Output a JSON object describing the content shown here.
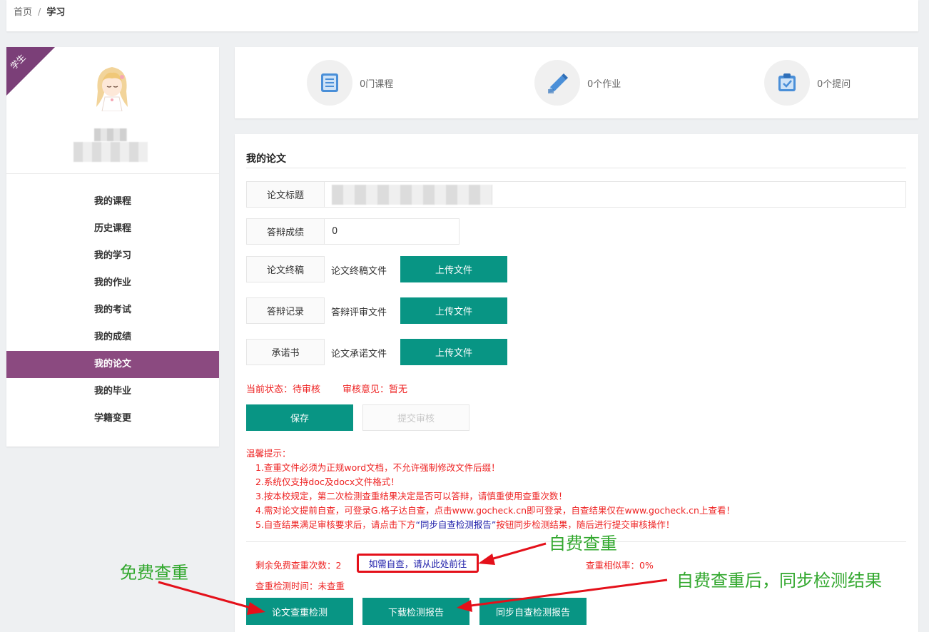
{
  "breadcrumb": {
    "home": "首页",
    "separator": "/",
    "current": "学习"
  },
  "sidebar": {
    "ribbon": "学生",
    "items": [
      {
        "label": "我的课程"
      },
      {
        "label": "历史课程"
      },
      {
        "label": "我的学习"
      },
      {
        "label": "我的作业"
      },
      {
        "label": "我的考试"
      },
      {
        "label": "我的成绩"
      },
      {
        "label": "我的论文",
        "active": true
      },
      {
        "label": "我的毕业"
      },
      {
        "label": "学籍变更"
      }
    ]
  },
  "stats": [
    {
      "icon": "document-icon",
      "label": "0门课程"
    },
    {
      "icon": "pencil-icon",
      "label": "0个作业"
    },
    {
      "icon": "clipboard-check-icon",
      "label": "0个提问"
    }
  ],
  "paper": {
    "title": "我的论文",
    "fields": {
      "thesis_title_label": "论文标题",
      "defense_score_label": "答辩成绩",
      "defense_score_value": "0",
      "final_draft_label": "论文终稿",
      "final_draft_file": "论文终稿文件",
      "defense_record_label": "答辩记录",
      "defense_record_file": "答辩评审文件",
      "commitment_label": "承诺书",
      "commitment_file": "论文承诺文件",
      "upload_label": "上传文件"
    },
    "status": {
      "current": "当前状态：待审核",
      "opinion": "审核意见：暂无"
    },
    "save_label": "保存",
    "submit_label": "提交审核",
    "tips": {
      "heading": "温馨提示：",
      "l1": "1.查重文件必须为正规word文档，不允许强制修改文件后缀！",
      "l2": "2.系统仅支持doc及docx文件格式！",
      "l3": "3.按本校规定，第二次检测查重结果决定是否可以答辩，请慎重使用查重次数！",
      "l4": "4.需对论文提前自查，可登录G.格子达自查，点击www.gocheck.cn即可登录，自查结果仅在www.gocheck.cn上查看！",
      "l5_a": "5.自查结果满足审核要求后，请点击下方",
      "l5_b": "“同步自查检测报告”",
      "l5_c": "按钮同步检测结果，随后进行提交审核操作！"
    },
    "check": {
      "remaining": "剩余免费查重次数：2",
      "self_check_link": "如需自查，请从此处前往",
      "similarity": "查重相似率：0%",
      "check_time": "查重检测时间：未查重",
      "btn_check": "论文查重检测",
      "btn_download": "下载检测报告",
      "btn_sync": "同步自查检测报告"
    }
  },
  "annotations": {
    "free_check": "免费查重",
    "self_pay_check": "自费查重",
    "self_pay_sync": "自费查重后，同步检测结果"
  },
  "colors": {
    "accent": "#089584",
    "sidebar_active": "#8b4a80",
    "warning": "#e22222",
    "annotation": "#33a82f",
    "arrow": "#e4101a"
  }
}
